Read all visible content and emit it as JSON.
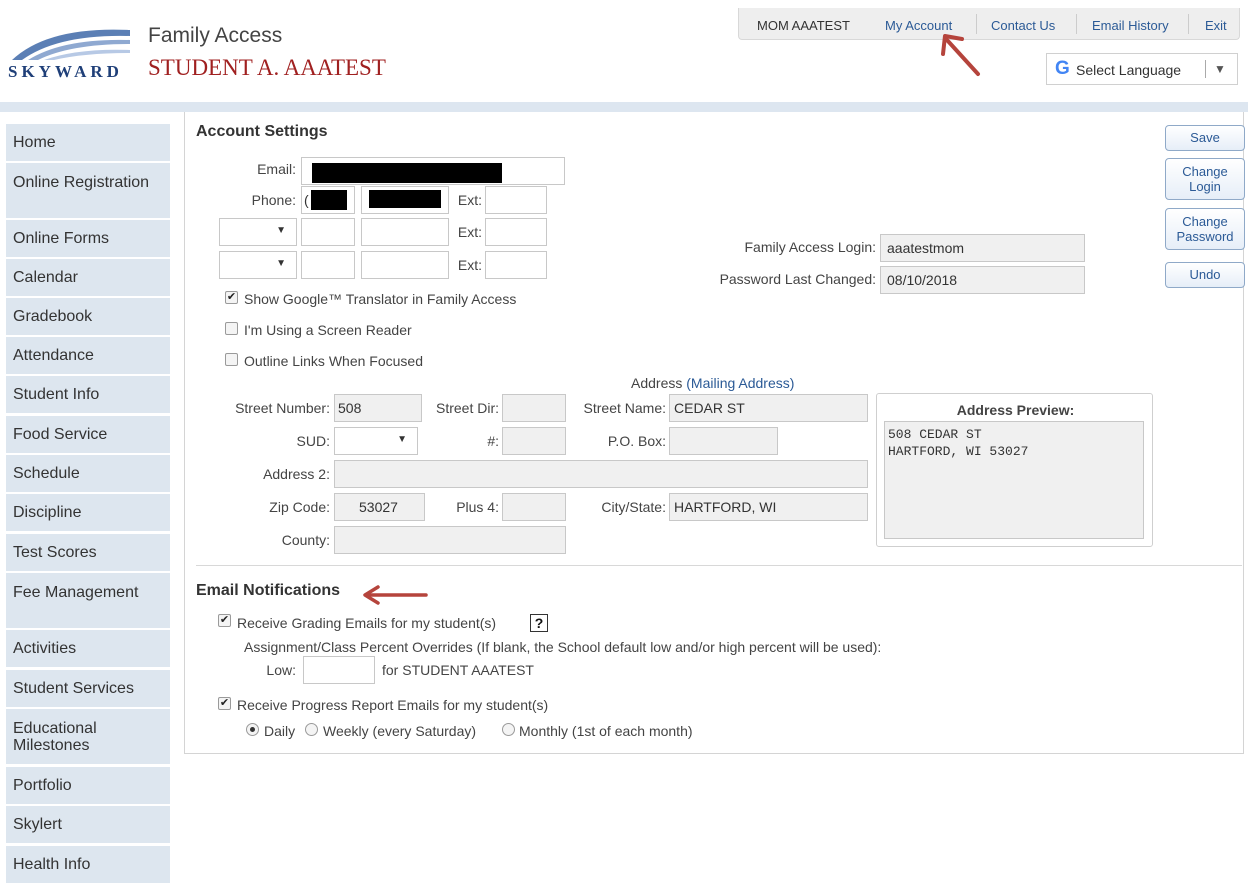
{
  "header": {
    "logo_text": "SKYWARD",
    "app_title": "Family Access",
    "student_name": "STUDENT A. AAATEST",
    "top_nav": {
      "user": "MOM AAATEST",
      "my_account": "My Account",
      "contact_us": "Contact Us",
      "email_history": "Email History",
      "exit": "Exit"
    },
    "language": {
      "label": "Select Language",
      "arrow": "▼",
      "icon": "google-icon"
    }
  },
  "sidebar": {
    "items": [
      {
        "label": "Home"
      },
      {
        "label": "Online Registration"
      },
      {
        "label": "Online Forms"
      },
      {
        "label": "Calendar"
      },
      {
        "label": "Gradebook"
      },
      {
        "label": "Attendance"
      },
      {
        "label": "Student Info"
      },
      {
        "label": "Food Service"
      },
      {
        "label": "Schedule"
      },
      {
        "label": "Discipline"
      },
      {
        "label": "Test Scores"
      },
      {
        "label": "Fee Management"
      },
      {
        "label": "Activities"
      },
      {
        "label": "Student Services"
      },
      {
        "label": "Educational Milestones"
      },
      {
        "label": "Portfolio"
      },
      {
        "label": "Skylert"
      },
      {
        "label": "Health Info"
      }
    ]
  },
  "account": {
    "title": "Account Settings",
    "email_label": "Email:",
    "phone_label": "Phone:",
    "phone_prefix": "(",
    "ext_label": "Ext:",
    "login_label": "Family Access Login:",
    "login_value": "aaatestmom",
    "pw_label": "Password Last Changed:",
    "pw_value": "08/10/2018",
    "show_translator": "Show Google™ Translator in Family Access",
    "screen_reader": "I'm Using a Screen Reader",
    "outline_links": "Outline Links When Focused",
    "check_mark": "✔"
  },
  "buttons": {
    "save": "Save",
    "change_login_1": "Change",
    "change_login_2": "Login",
    "change_password_1": "Change",
    "change_password_2": "Password",
    "undo": "Undo"
  },
  "address": {
    "heading": "Address",
    "heading_link": "(Mailing Address)",
    "street_number_label": "Street Number:",
    "street_number": "508",
    "street_dir_label": "Street Dir:",
    "street_name_label": "Street Name:",
    "street_name": "CEDAR ST",
    "sud_label": "SUD:",
    "num_label": "#:",
    "po_label": "P.O. Box:",
    "address2_label": "Address 2:",
    "zip_label": "Zip Code:",
    "zip": "53027",
    "plus4_label": "Plus 4:",
    "city_label": "City/State:",
    "city": "HARTFORD, WI",
    "county_label": "County:",
    "preview_title": "Address Preview:",
    "preview_line1": "508 CEDAR ST",
    "preview_line2": "HARTFORD, WI 53027"
  },
  "notifications": {
    "title": "Email Notifications",
    "grading": "Receive Grading Emails for my student(s)",
    "help": "?",
    "overrides": "Assignment/Class Percent Overrides (If blank, the School default low and/or high percent will be used):",
    "low_label": "Low:",
    "for_student": "for STUDENT AAATEST",
    "progress": "Receive Progress Report Emails for my student(s)",
    "daily": "Daily",
    "weekly": "Weekly (every Saturday)",
    "monthly": "Monthly (1st of each month)",
    "selected_frequency": "Daily"
  }
}
